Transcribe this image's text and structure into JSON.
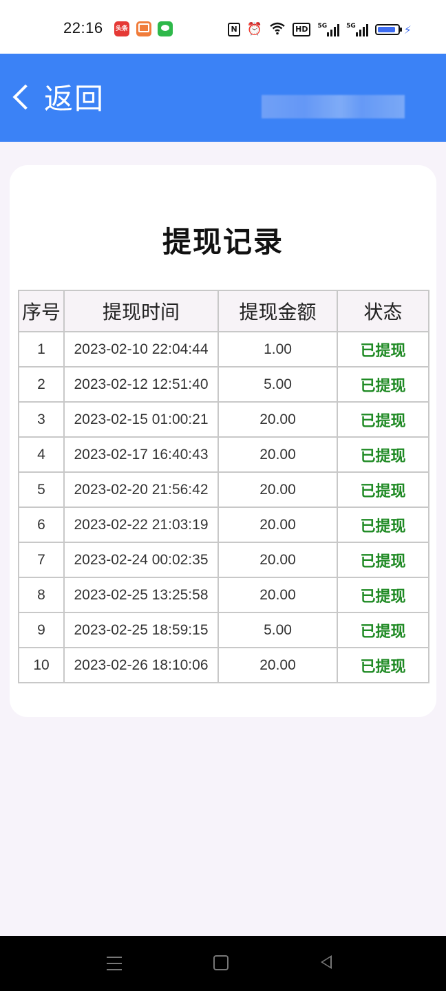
{
  "status_bar": {
    "time": "22:16",
    "apps": [
      {
        "icon": "toutiao-icon",
        "label": "头条",
        "color": "#e53935"
      },
      {
        "icon": "orange-app-icon",
        "label": "",
        "color": "#f07c3a"
      },
      {
        "icon": "wechat-icon",
        "label": "",
        "color": "#2eb84a"
      }
    ],
    "nfc_label": "N",
    "hd_label": "HD",
    "signal_label": "5G",
    "battery_level": 0.9,
    "battery_color": "#3d6cf0"
  },
  "header": {
    "back_label": "返回",
    "background": "#3b82f6"
  },
  "card": {
    "title": "提现记录",
    "columns": [
      "序号",
      "提现时间",
      "提现金额",
      "状态"
    ],
    "rows": [
      {
        "no": "1",
        "time": "2023-02-10 22:04:44",
        "amount": "1.00",
        "status": "已提现"
      },
      {
        "no": "2",
        "time": "2023-02-12 12:51:40",
        "amount": "5.00",
        "status": "已提现"
      },
      {
        "no": "3",
        "time": "2023-02-15 01:00:21",
        "amount": "20.00",
        "status": "已提现"
      },
      {
        "no": "4",
        "time": "2023-02-17 16:40:43",
        "amount": "20.00",
        "status": "已提现"
      },
      {
        "no": "5",
        "time": "2023-02-20 21:56:42",
        "amount": "20.00",
        "status": "已提现"
      },
      {
        "no": "6",
        "time": "2023-02-22 21:03:19",
        "amount": "20.00",
        "status": "已提现"
      },
      {
        "no": "7",
        "time": "2023-02-24 00:02:35",
        "amount": "20.00",
        "status": "已提现"
      },
      {
        "no": "8",
        "time": "2023-02-25 13:25:58",
        "amount": "20.00",
        "status": "已提现"
      },
      {
        "no": "9",
        "time": "2023-02-25 18:59:15",
        "amount": "5.00",
        "status": "已提现"
      },
      {
        "no": "10",
        "time": "2023-02-26 18:10:06",
        "amount": "20.00",
        "status": "已提现"
      }
    ],
    "status_color": "#1f8a24"
  }
}
